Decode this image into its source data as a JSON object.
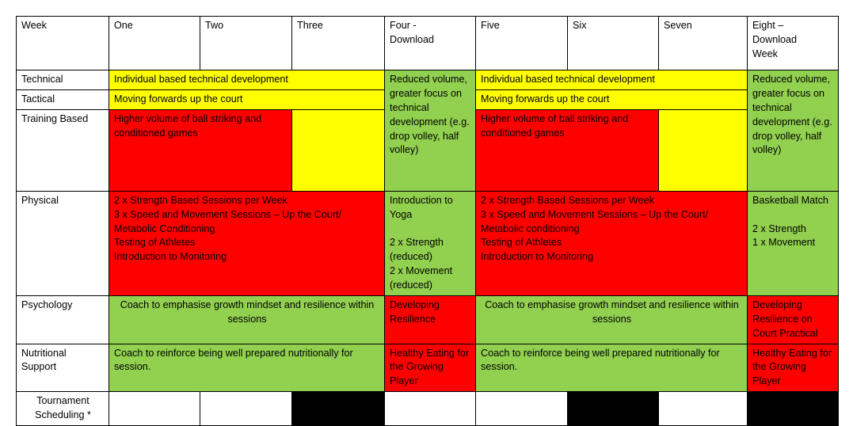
{
  "document": {
    "title": "Training Periodization Table",
    "type": "table"
  },
  "colors": {
    "yellow": "#ffff00",
    "red": "#ff0000",
    "green": "#92d050",
    "black": "#000000",
    "white": "#ffffff",
    "border": "#000000"
  },
  "table": {
    "row_labels": {
      "week": "Week",
      "technical": "Technical",
      "tactical": "Tactical",
      "training_based": "Training Based",
      "physical": "Physical",
      "psychology": "Psychology",
      "nutritional_support": "Nutritional\nSupport",
      "nutritional_support_line1": "Nutritional",
      "nutritional_support_line2": "Support",
      "tournament_scheduling_line1": "Tournament",
      "tournament_scheduling_line2": "Scheduling *"
    },
    "week_headers": {
      "one": "One",
      "two": "Two",
      "three": "Three",
      "four_line1": "Four -",
      "four_line2": "Download",
      "five": "Five",
      "six": "Six",
      "seven": "Seven",
      "eight_line1": "Eight –",
      "eight_line2": "Download",
      "eight_line3": "Week"
    },
    "cells": {
      "technical_block_1": "Individual based technical development",
      "technical_download_1": "Reduced volume, greater focus on technical development (e.g. drop volley, half volley)",
      "technical_block_2": "Individual based technical development",
      "technical_download_2": "Reduced volume, greater focus on technical development (e.g. drop volley, half volley)",
      "tactical_block_1": "Moving forwards up the court",
      "tactical_block_2": "Moving forwards up the court",
      "training_block_1": "Higher volume of ball striking and conditioned games",
      "training_block_2": "Higher volume of ball striking and conditioned games",
      "physical_block_1": "2 x Strength Based Sessions per Week\n3 x Speed and Movement Sessions – Up the Court/ Metabolic Conditioning\nTesting of Athletes\nIntroduction to Monitoring",
      "physical_block_1_lines": [
        "2 x Strength Based Sessions per Week",
        "3 x Speed and Movement Sessions – Up the Court/",
        "Metabolic Conditioning",
        "Testing of Athletes",
        "Introduction to Monitoring"
      ],
      "physical_download_1_lines": [
        "Introduction to Yoga",
        "",
        "2 x Strength (reduced)",
        "2 x Movement (reduced)"
      ],
      "physical_block_2_lines": [
        "2 x Strength Based Sessions per Week",
        "3 x Speed and Movement Sessions – Up the Court/",
        "Metabolic conditioning",
        "Testing of Athletes",
        "Introduction to Monitoring"
      ],
      "physical_download_2_lines": [
        "Basketball Match",
        "",
        "2 x Strength",
        "1 x Movement"
      ],
      "psychology_block_1": "Coach to emphasise growth mindset and resilience within sessions",
      "psychology_download_1": "Developing Resilience",
      "psychology_block_2": "Coach to emphasise growth mindset and resilience within sessions",
      "psychology_download_2": "Developing Resilience on Court Practical",
      "nutrition_block_1": "Coach to reinforce being well prepared nutritionally for session.",
      "nutrition_download_1": "Healthy Eating for the Growing Player",
      "nutrition_block_2": "Coach to reinforce being well prepared nutritionally for session.",
      "nutrition_download_2": "Healthy Eating for the Growing Player",
      "tournament_empty": ""
    }
  }
}
